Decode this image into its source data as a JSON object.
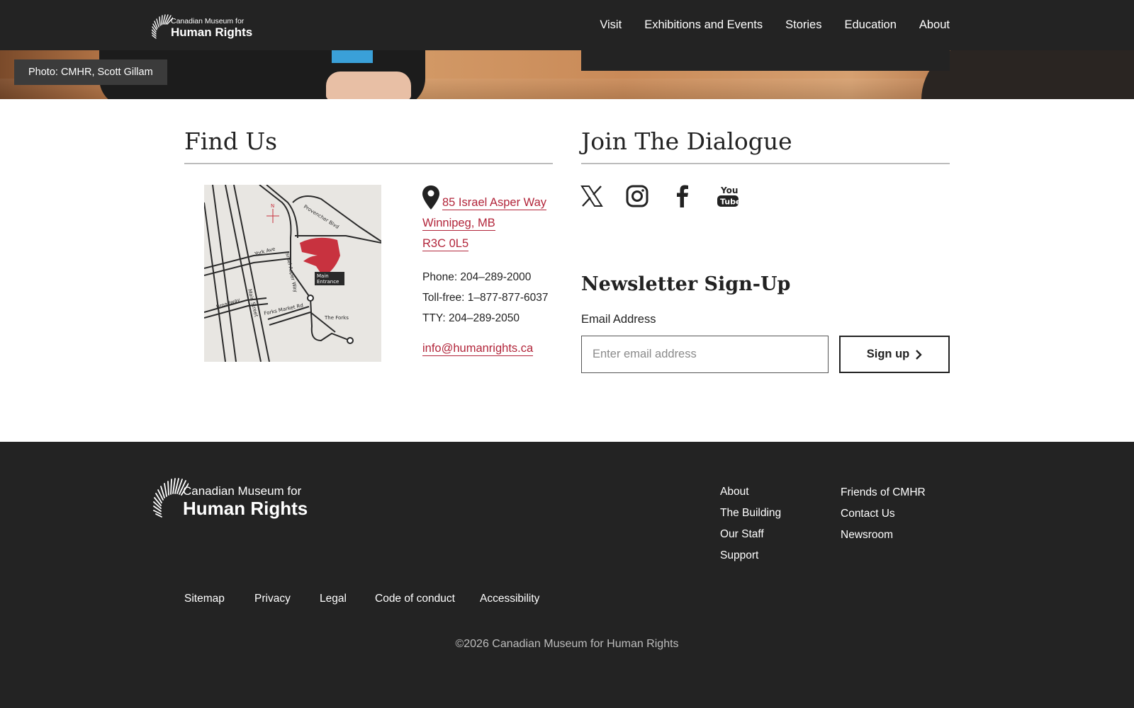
{
  "header": {
    "logo": {
      "line1": "Canadian Museum for",
      "line2": "Human Rights"
    },
    "nav": [
      "Visit",
      "Exhibitions and Events",
      "Stories",
      "Education",
      "About"
    ]
  },
  "hero": {
    "caption": "Photo: CMHR, Scott Gillam"
  },
  "find_us": {
    "title": "Find Us",
    "map": {
      "streets": [
        "Provencher Blvd",
        "York Ave",
        "Israel Asper Way",
        "Broadway",
        "Main Street",
        "Forks Market Rd",
        "The Forks"
      ],
      "north": "N",
      "entrance": [
        "Main",
        "Entrance"
      ]
    },
    "address": {
      "line1": "85 Israel Asper Way",
      "line2": "Winnipeg, MB",
      "line3": "R3C 0L5"
    },
    "phone": "Phone: 204–289-2000",
    "tollfree": "Toll-free: 1–877-877-6037",
    "tty": "TTY: 204–289-2050",
    "email": "info@humanrights.ca"
  },
  "dialogue": {
    "title": "Join The Dialogue",
    "social_icons": [
      "x-icon",
      "instagram-icon",
      "facebook-icon",
      "youtube-icon"
    ],
    "youtube_text": [
      "You",
      "Tube"
    ]
  },
  "newsletter": {
    "title": "Newsletter Sign-Up",
    "label": "Email Address",
    "placeholder": "Enter email address",
    "button": "Sign up"
  },
  "footer": {
    "logo": {
      "line1": "Canadian Museum for",
      "line2": "Human Rights"
    },
    "col1": [
      "About",
      "The Building",
      "Our Staff",
      "Support"
    ],
    "col2": [
      "Friends of CMHR",
      "Contact Us",
      "Newsroom"
    ],
    "bottom_links": [
      "Sitemap",
      "Privacy",
      "Legal",
      "Code of conduct",
      "Accessibility"
    ],
    "copyright": "©2026 Canadian Museum for Human Rights"
  },
  "colors": {
    "dark": "#232323",
    "link": "#b2253a",
    "accent_red": "#c8323f"
  }
}
